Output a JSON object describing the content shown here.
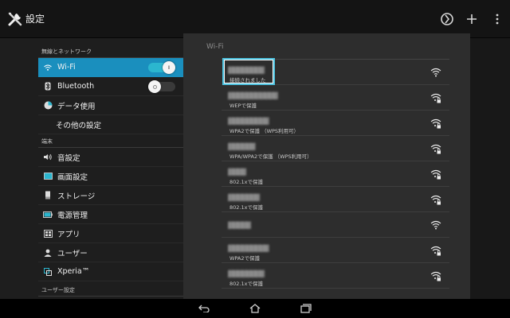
{
  "app": {
    "title": "設定",
    "icon": "tools-icon"
  },
  "actionbar": {
    "buttons": [
      "sync-icon",
      "add-icon",
      "overflow-menu-icon"
    ]
  },
  "left": {
    "sections": [
      {
        "header": "無線とネットワーク"
      },
      {
        "header": "端末"
      },
      {
        "header": "ユーザー設定"
      }
    ],
    "items": [
      {
        "label": "Wi-Fi",
        "icon": "wifi-icon",
        "active": true,
        "toggle": "on"
      },
      {
        "label": "Bluetooth",
        "icon": "bluetooth-icon",
        "toggle": "off"
      },
      {
        "label": "データ使用",
        "icon": "data-usage-icon"
      },
      {
        "label": "その他の設定",
        "icon": ""
      },
      {
        "label": "音設定",
        "icon": "sound-icon"
      },
      {
        "label": "画面設定",
        "icon": "display-icon"
      },
      {
        "label": "ストレージ",
        "icon": "storage-icon"
      },
      {
        "label": "電源管理",
        "icon": "battery-icon"
      },
      {
        "label": "アプリ",
        "icon": "apps-icon"
      },
      {
        "label": "ユーザー",
        "icon": "user-icon"
      },
      {
        "label": "Xperia™",
        "icon": "xperia-icon"
      }
    ]
  },
  "right": {
    "title": "Wi-Fi",
    "networks": [
      {
        "name": "▓▓▓▓▓▓▓▓",
        "status": "接続されました",
        "locked": false,
        "selected": true
      },
      {
        "name": "▓▓▓▓▓▓▓▓▓▓▓",
        "status": "WEPで保護",
        "locked": true
      },
      {
        "name": "▓▓▓▓▓▓▓▓▓",
        "status": "WPA2で保護 （WPS利用可）",
        "locked": true
      },
      {
        "name": "▓▓▓▓▓▓",
        "status": "WPA/WPA2で保護 （WPS利用可）",
        "locked": true
      },
      {
        "name": "▓▓▓▓",
        "status": "802.1xで保護",
        "locked": true
      },
      {
        "name": "▓▓▓▓▓▓▓",
        "status": "802.1xで保護",
        "locked": true
      },
      {
        "name": "▓▓▓▓▓",
        "status": "",
        "locked": false
      },
      {
        "name": "▓▓▓▓▓▓▓▓▓",
        "status": "WPA2で保護",
        "locked": true
      },
      {
        "name": "▓▓▓▓▓▓▓▓",
        "status": "802.1xで保護",
        "locked": true
      }
    ]
  },
  "navbar": {
    "buttons": [
      "back-icon",
      "home-icon",
      "recent-apps-icon"
    ]
  },
  "colors": {
    "accent": "#1a8fbe",
    "toggle_on": "#2bb6cf",
    "selection": "#4ec3e0"
  }
}
